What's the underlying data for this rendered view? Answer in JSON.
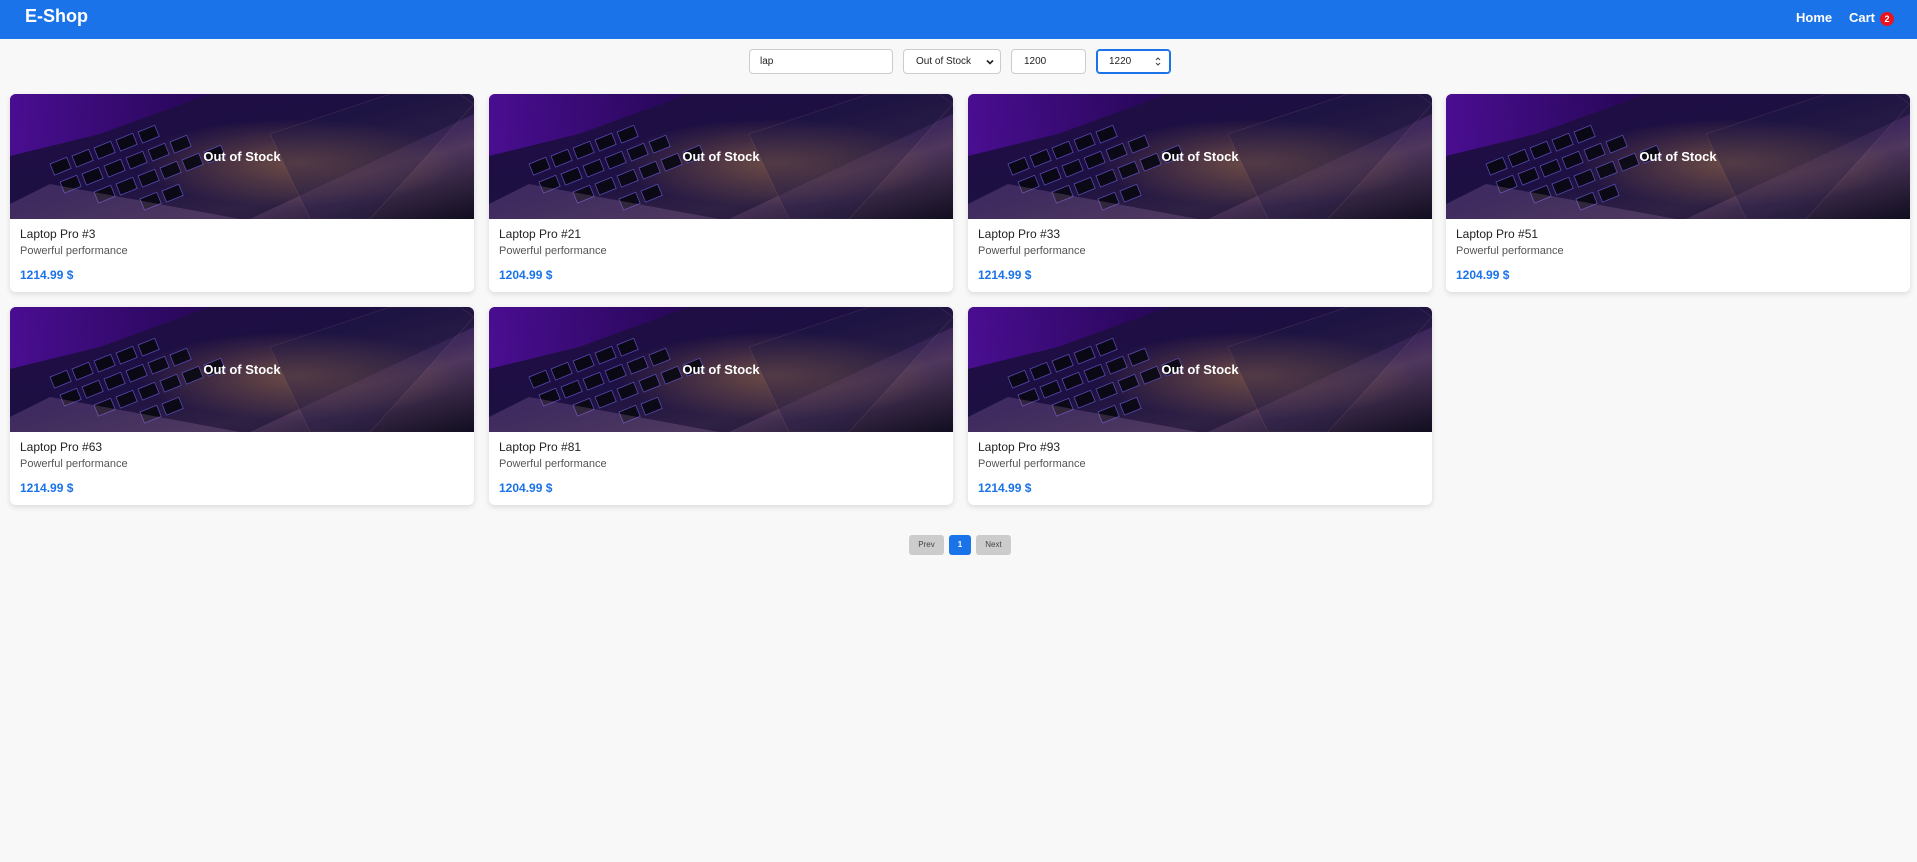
{
  "header": {
    "brand": "E-Shop",
    "nav_home": "Home",
    "nav_cart": "Cart",
    "cart_count": "2",
    "accent_color": "#1a73e8",
    "badge_color": "#e8141e"
  },
  "filters": {
    "search_value": "lap",
    "stock_selected": "Out of Stock",
    "min_price": "1200",
    "max_price": "1220"
  },
  "products": [
    {
      "name": "Laptop Pro #3",
      "description": "Powerful performance",
      "price": "1214.99 $",
      "stock_label": "Out of Stock"
    },
    {
      "name": "Laptop Pro #21",
      "description": "Powerful performance",
      "price": "1204.99 $",
      "stock_label": "Out of Stock"
    },
    {
      "name": "Laptop Pro #33",
      "description": "Powerful performance",
      "price": "1214.99 $",
      "stock_label": "Out of Stock"
    },
    {
      "name": "Laptop Pro #51",
      "description": "Powerful performance",
      "price": "1204.99 $",
      "stock_label": "Out of Stock"
    },
    {
      "name": "Laptop Pro #63",
      "description": "Powerful performance",
      "price": "1214.99 $",
      "stock_label": "Out of Stock"
    },
    {
      "name": "Laptop Pro #81",
      "description": "Powerful performance",
      "price": "1204.99 $",
      "stock_label": "Out of Stock"
    },
    {
      "name": "Laptop Pro #93",
      "description": "Powerful performance",
      "price": "1214.99 $",
      "stock_label": "Out of Stock"
    }
  ],
  "pagination": {
    "prev": "Prev",
    "current": "1",
    "next": "Next"
  }
}
